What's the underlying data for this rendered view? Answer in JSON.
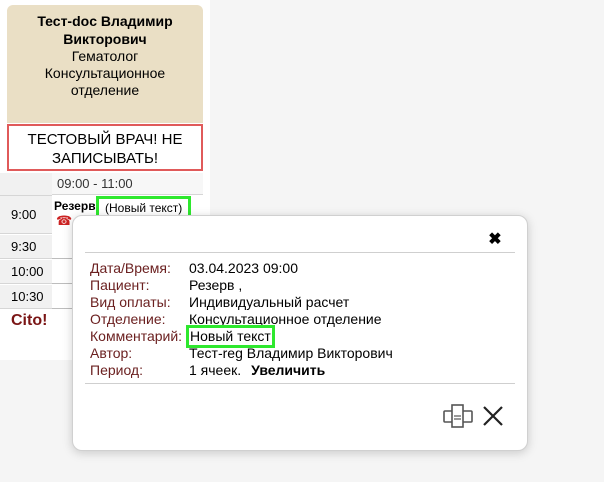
{
  "doctor": {
    "name": "Тест-doc Владимир Викторович",
    "specialty": "Гематолог",
    "department_line1": "Консультационное",
    "department_line2": "отделение"
  },
  "warning": {
    "line1": "ТЕСТОВЫЙ ВРАЧ! НЕ",
    "line2": "ЗАПИСЫВАТЬ!"
  },
  "schedule": {
    "range_header": "09:00 - 11:00",
    "slots": [
      "9:00",
      "9:30",
      "10:00",
      "10:30"
    ],
    "cito_label": "Cito!",
    "appointment": {
      "patient": "Резерв",
      "comment": "(Новый текст)"
    }
  },
  "modal": {
    "close_symbol": "✖",
    "details": [
      {
        "label": "Дата/Время:",
        "value": "03.04.2023 09:00"
      },
      {
        "label": "Пациент:",
        "value": "Резерв ,"
      },
      {
        "label": "Вид оплаты:",
        "value": "Индивидуальный расчет"
      },
      {
        "label": "Отделение:",
        "value": "Консультационное отделение"
      },
      {
        "label": "Комментарий:",
        "value": "Новый текст"
      },
      {
        "label": "Автор:",
        "value": "Тест-reg Владимир Викторович"
      },
      {
        "label": "Период:",
        "value": "1 ячеек."
      }
    ],
    "enlarge_label": "Увеличить"
  },
  "colors": {
    "highlight": "#2ee82e",
    "warning_border": "#e05a5a",
    "label_color": "#6b2020",
    "doctor_card_bg": "#eadfc5"
  },
  "icons": {
    "phone": "phone-icon",
    "print": "printer-icon",
    "close": "close-icon"
  }
}
